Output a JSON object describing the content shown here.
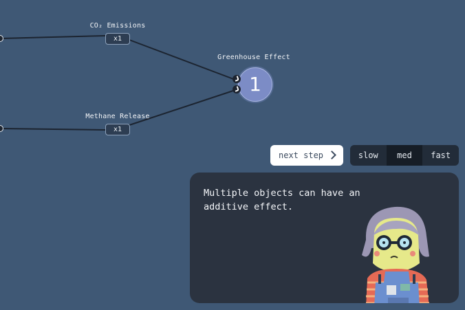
{
  "nodes": {
    "co2": {
      "label": "CO₂ Emissions",
      "multiplier": "x1"
    },
    "methane": {
      "label": "Methane Release",
      "multiplier": "x1"
    },
    "result": {
      "label": "Greenhouse Effect",
      "value": "1"
    }
  },
  "controls": {
    "next_label": "next step",
    "speeds": [
      "slow",
      "med",
      "fast"
    ],
    "active_speed": "med"
  },
  "dialog": {
    "text": "Multiple objects can have an additive effect."
  },
  "colors": {
    "background": "#3f5875",
    "dialog": "#2b3340",
    "result_node": "#7c8cc6"
  }
}
